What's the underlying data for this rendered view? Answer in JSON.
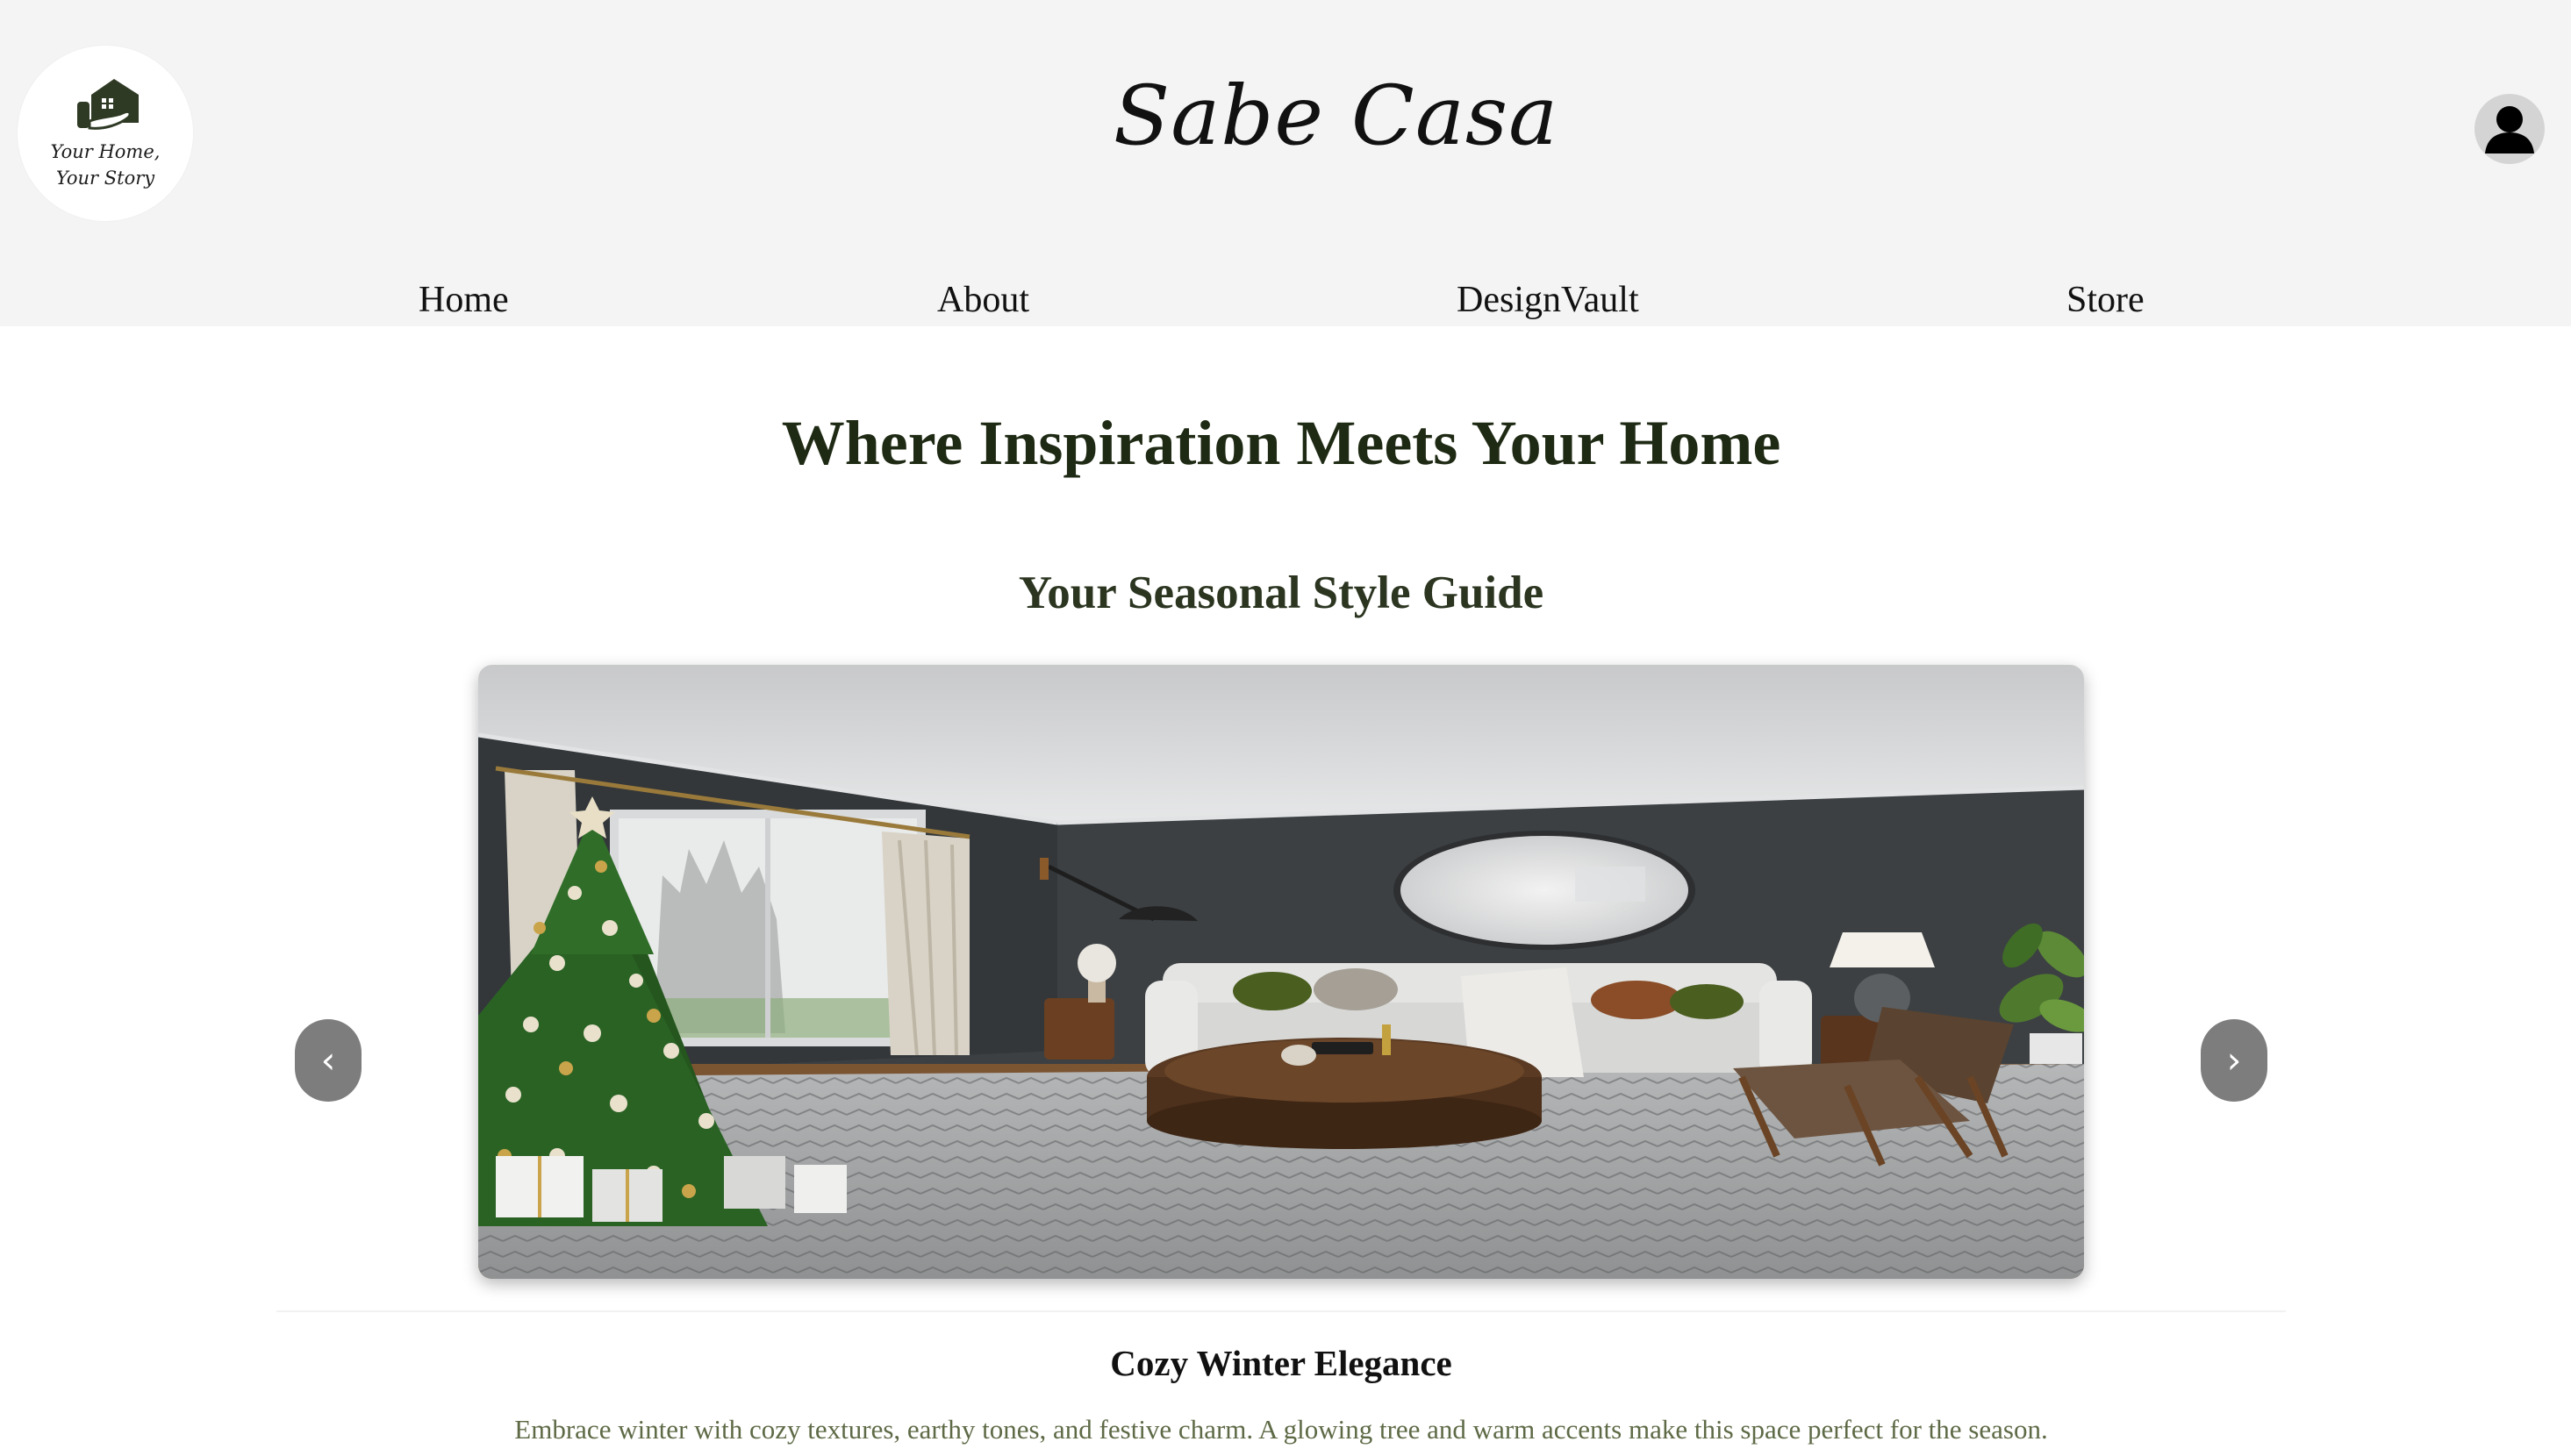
{
  "brand": {
    "name": "Sabe Casa",
    "logo_tagline_line1": "Your Home,",
    "logo_tagline_line2": "Your Story",
    "logo_icon": "house-hand-icon",
    "user_icon": "user-avatar-icon"
  },
  "nav": {
    "items": [
      "Home",
      "About",
      "DesignVault",
      "Store"
    ]
  },
  "hero": {
    "heading": "Where Inspiration Meets Your Home",
    "subheading": "Your Seasonal Style Guide"
  },
  "carousel": {
    "prev_label": "‹",
    "next_label": "›",
    "slide": {
      "title": "Cozy Winter Elegance",
      "description": "Embrace winter with cozy textures, earthy tones, and festive charm. A glowing tree and warm accents make this space perfect for the season."
    }
  },
  "colors": {
    "header_bg": "#f4f4f4",
    "heading": "#1f2a14",
    "accent_green": "#2f3a25",
    "caption_text": "#5e6a46",
    "arrow_bg": "#7d7d7d"
  }
}
